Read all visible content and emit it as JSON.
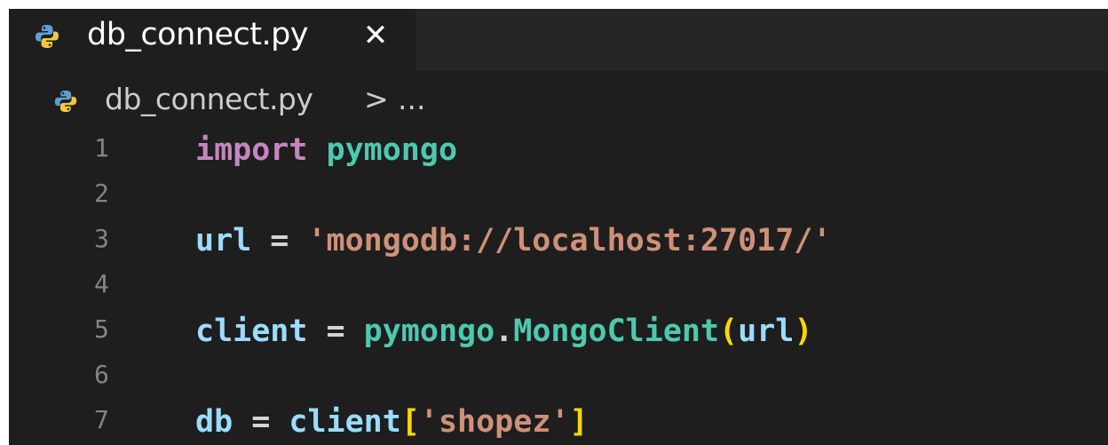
{
  "tab": {
    "file_name": "db_connect.py",
    "close_glyph": "✕",
    "icon": "python-icon"
  },
  "breadcrumb": {
    "file_name": "db_connect.py",
    "separator": ">",
    "more": "...",
    "icon": "python-icon"
  },
  "colors": {
    "background": "#1e1e1e",
    "keyword": "#c586c0",
    "module": "#4ec9b0",
    "variable": "#9cdcfe",
    "string": "#ce9178",
    "bracket": "#ffd700",
    "line_number": "#858585"
  },
  "code": {
    "lines": [
      {
        "number": "1",
        "tokens": {
          "t1": "import",
          "t2": " ",
          "t3": "pymongo"
        }
      },
      {
        "number": "2"
      },
      {
        "number": "3",
        "tokens": {
          "t1": "url",
          "t2": " = ",
          "t3": "'mongodb://localhost:27017/'"
        }
      },
      {
        "number": "4"
      },
      {
        "number": "5",
        "tokens": {
          "t1": "client",
          "t2": " = ",
          "t3": "pymongo",
          "t4": ".",
          "t5": "MongoClient",
          "t6": "(",
          "t7": "url",
          "t8": ")"
        }
      },
      {
        "number": "6"
      },
      {
        "number": "7",
        "tokens": {
          "t1": "db",
          "t2": " = ",
          "t3": "client",
          "t4": "[",
          "t5": "'shopez'",
          "t6": "]"
        }
      }
    ]
  }
}
